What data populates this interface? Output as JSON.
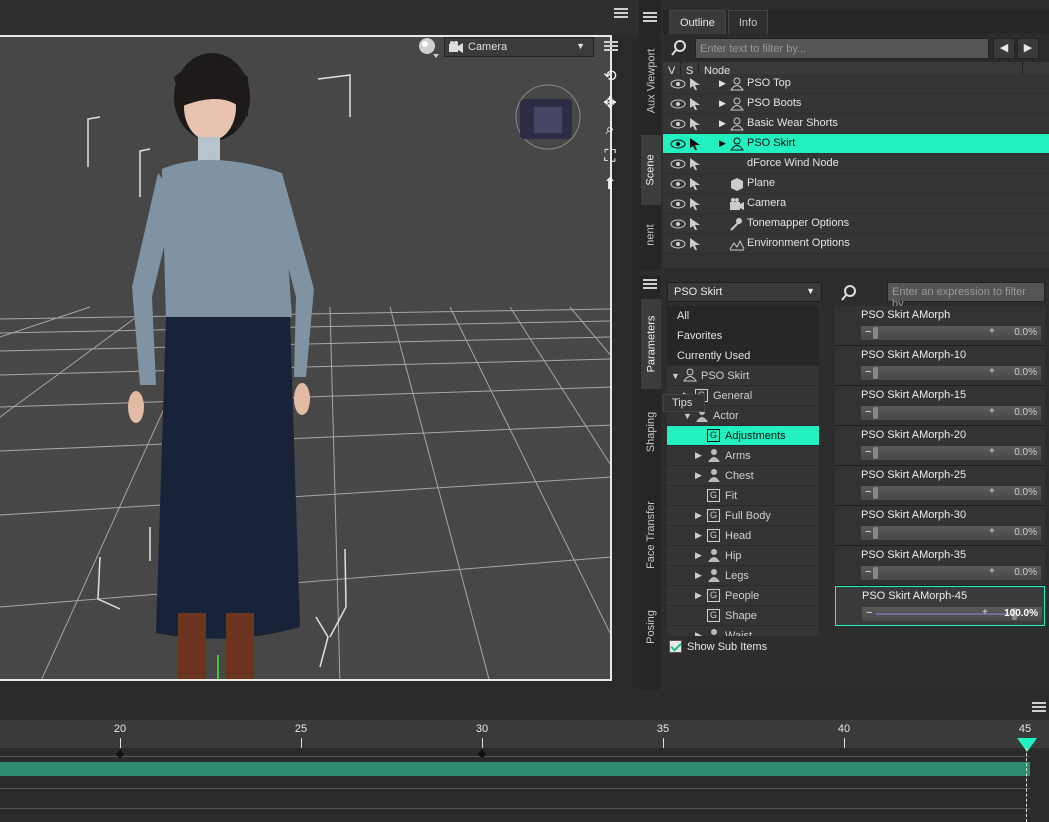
{
  "viewport": {
    "camera_label": "Camera",
    "nav_tools": [
      "rotate-icon",
      "pan-icon",
      "zoom-icon",
      "frame-icon",
      "home-icon"
    ]
  },
  "scene": {
    "tabs": [
      "Outline",
      "Info"
    ],
    "filter_placeholder": "Enter text to filter by...",
    "columns": [
      "V",
      "S",
      "Node"
    ],
    "nodes": [
      {
        "label": "PSO Top",
        "expandable": true,
        "icon": "figure-icon",
        "selected": false
      },
      {
        "label": "PSO Boots",
        "expandable": true,
        "icon": "figure-icon",
        "selected": false
      },
      {
        "label": "Basic Wear Shorts",
        "expandable": true,
        "icon": "figure-icon",
        "selected": false
      },
      {
        "label": "PSO Skirt",
        "expandable": true,
        "icon": "figure-icon",
        "selected": true
      },
      {
        "label": "dForce Wind Node",
        "expandable": false,
        "icon": "wind-icon",
        "selected": false
      },
      {
        "label": "Plane",
        "expandable": false,
        "icon": "cube-icon",
        "selected": false
      },
      {
        "label": "Camera",
        "expandable": false,
        "icon": "camera-icon",
        "selected": false
      },
      {
        "label": "Tonemapper Options",
        "expandable": false,
        "icon": "tonemap-icon",
        "selected": false
      },
      {
        "label": "Environment Options",
        "expandable": false,
        "icon": "env-icon",
        "selected": false
      }
    ],
    "side_tabs": [
      "Aux Viewport",
      "Scene",
      "nent"
    ]
  },
  "parameters": {
    "node_select": "PSO Skirt",
    "expr_placeholder": "Enter an expression to filter by...",
    "side_tabs": [
      "Parameters",
      "Shaping",
      "Face Transfer",
      "Posing"
    ],
    "categories": [
      {
        "label": "All",
        "style": "dark",
        "indent": 0,
        "icon": "none",
        "expand": ""
      },
      {
        "label": "Favorites",
        "style": "dark",
        "indent": 0,
        "icon": "none",
        "expand": ""
      },
      {
        "label": "Currently Used",
        "style": "dark",
        "indent": 0,
        "icon": "none",
        "expand": ""
      },
      {
        "label": "PSO Skirt",
        "style": "normal",
        "indent": 0,
        "icon": "figure",
        "expand": "▼"
      },
      {
        "label": "General",
        "style": "normal",
        "indent": 1,
        "icon": "group",
        "expand": "▶"
      },
      {
        "label": "Actor",
        "style": "normal",
        "indent": 1,
        "icon": "person",
        "expand": "▼"
      },
      {
        "label": "Adjustments",
        "style": "sel",
        "indent": 2,
        "icon": "group",
        "expand": ""
      },
      {
        "label": "Arms",
        "style": "normal",
        "indent": 2,
        "icon": "person",
        "expand": "▶"
      },
      {
        "label": "Chest",
        "style": "normal",
        "indent": 2,
        "icon": "person",
        "expand": "▶"
      },
      {
        "label": "Fit",
        "style": "normal",
        "indent": 2,
        "icon": "group",
        "expand": ""
      },
      {
        "label": "Full Body",
        "style": "normal",
        "indent": 2,
        "icon": "group",
        "expand": "▶"
      },
      {
        "label": "Head",
        "style": "normal",
        "indent": 2,
        "icon": "group",
        "expand": "▶"
      },
      {
        "label": "Hip",
        "style": "normal",
        "indent": 2,
        "icon": "person",
        "expand": "▶"
      },
      {
        "label": "Legs",
        "style": "normal",
        "indent": 2,
        "icon": "person",
        "expand": "▶"
      },
      {
        "label": "People",
        "style": "normal",
        "indent": 2,
        "icon": "group",
        "expand": "▶"
      },
      {
        "label": "Shape",
        "style": "normal",
        "indent": 2,
        "icon": "group",
        "expand": ""
      },
      {
        "label": "Waist",
        "style": "normal",
        "indent": 2,
        "icon": "person",
        "expand": "▶"
      }
    ],
    "show_sub_items": "Show Sub Items",
    "sliders": [
      {
        "name": "PSO Skirt AMorph",
        "value": "0.0%",
        "level": 0,
        "active": false
      },
      {
        "name": "PSO Skirt AMorph-10",
        "value": "0.0%",
        "level": 0,
        "active": false
      },
      {
        "name": "PSO Skirt AMorph-15",
        "value": "0.0%",
        "level": 0,
        "active": false
      },
      {
        "name": "PSO Skirt AMorph-20",
        "value": "0.0%",
        "level": 0,
        "active": false
      },
      {
        "name": "PSO Skirt AMorph-25",
        "value": "0.0%",
        "level": 0,
        "active": false
      },
      {
        "name": "PSO Skirt AMorph-30",
        "value": "0.0%",
        "level": 0,
        "active": false
      },
      {
        "name": "PSO Skirt AMorph-35",
        "value": "0.0%",
        "level": 0,
        "active": false
      },
      {
        "name": "PSO Skirt AMorph-45",
        "value": "100.0%",
        "level": 1,
        "active": true
      }
    ],
    "tips_label": "Tips"
  },
  "timeline": {
    "labels": [
      "20",
      "25",
      "30",
      "35",
      "40",
      "45"
    ],
    "current_frame": 45,
    "key_frames": [
      20,
      30
    ]
  },
  "colors": {
    "accent": "#22f0c0",
    "track": "#2e8c70"
  }
}
